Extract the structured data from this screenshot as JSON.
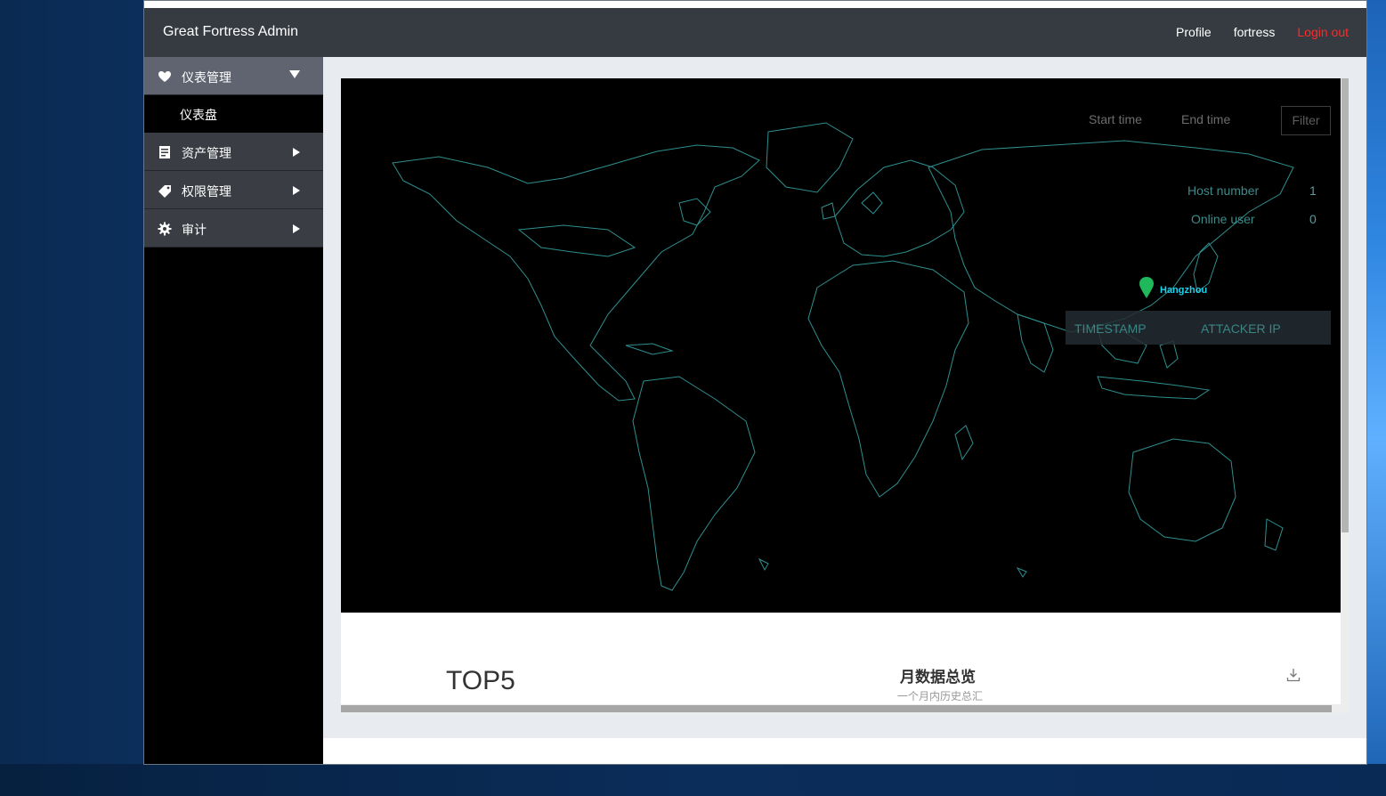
{
  "app": {
    "brand": "Great Fortress Admin"
  },
  "header_nav": {
    "profile": "Profile",
    "user": "fortress",
    "logout": "Login out"
  },
  "sidebar": {
    "items": [
      {
        "label": "仪表管理",
        "icon": "heart-icon",
        "expanded": true
      },
      {
        "label": "资产管理",
        "icon": "document-icon",
        "expanded": false
      },
      {
        "label": "权限管理",
        "icon": "tag-icon",
        "expanded": false
      },
      {
        "label": "审计",
        "icon": "gear-icon",
        "expanded": false
      }
    ],
    "submenu": {
      "dashboard": "仪表盘"
    }
  },
  "map_panel": {
    "start_time_placeholder": "Start time",
    "end_time_placeholder": "End time",
    "filter_label": "Filter",
    "host_number_label": "Host number",
    "host_number_value": "1",
    "online_user_label": "Online user",
    "online_user_value": "0",
    "marker_city": "Hangzhou",
    "table_headers": [
      "TIMESTAMP",
      "ATTACKER IP"
    ]
  },
  "bottom": {
    "top5_title": "TOP5",
    "month_title": "月数据总览",
    "month_subtitle": "一个月内历史总汇"
  },
  "colors": {
    "header_bg": "#353b40",
    "sidebar_active": "#5f6470",
    "logout_color": "#ff2a2a",
    "map_outline": "#2f8f8f",
    "marker_green": "#1fb85a",
    "marker_label": "#19d4f0"
  }
}
